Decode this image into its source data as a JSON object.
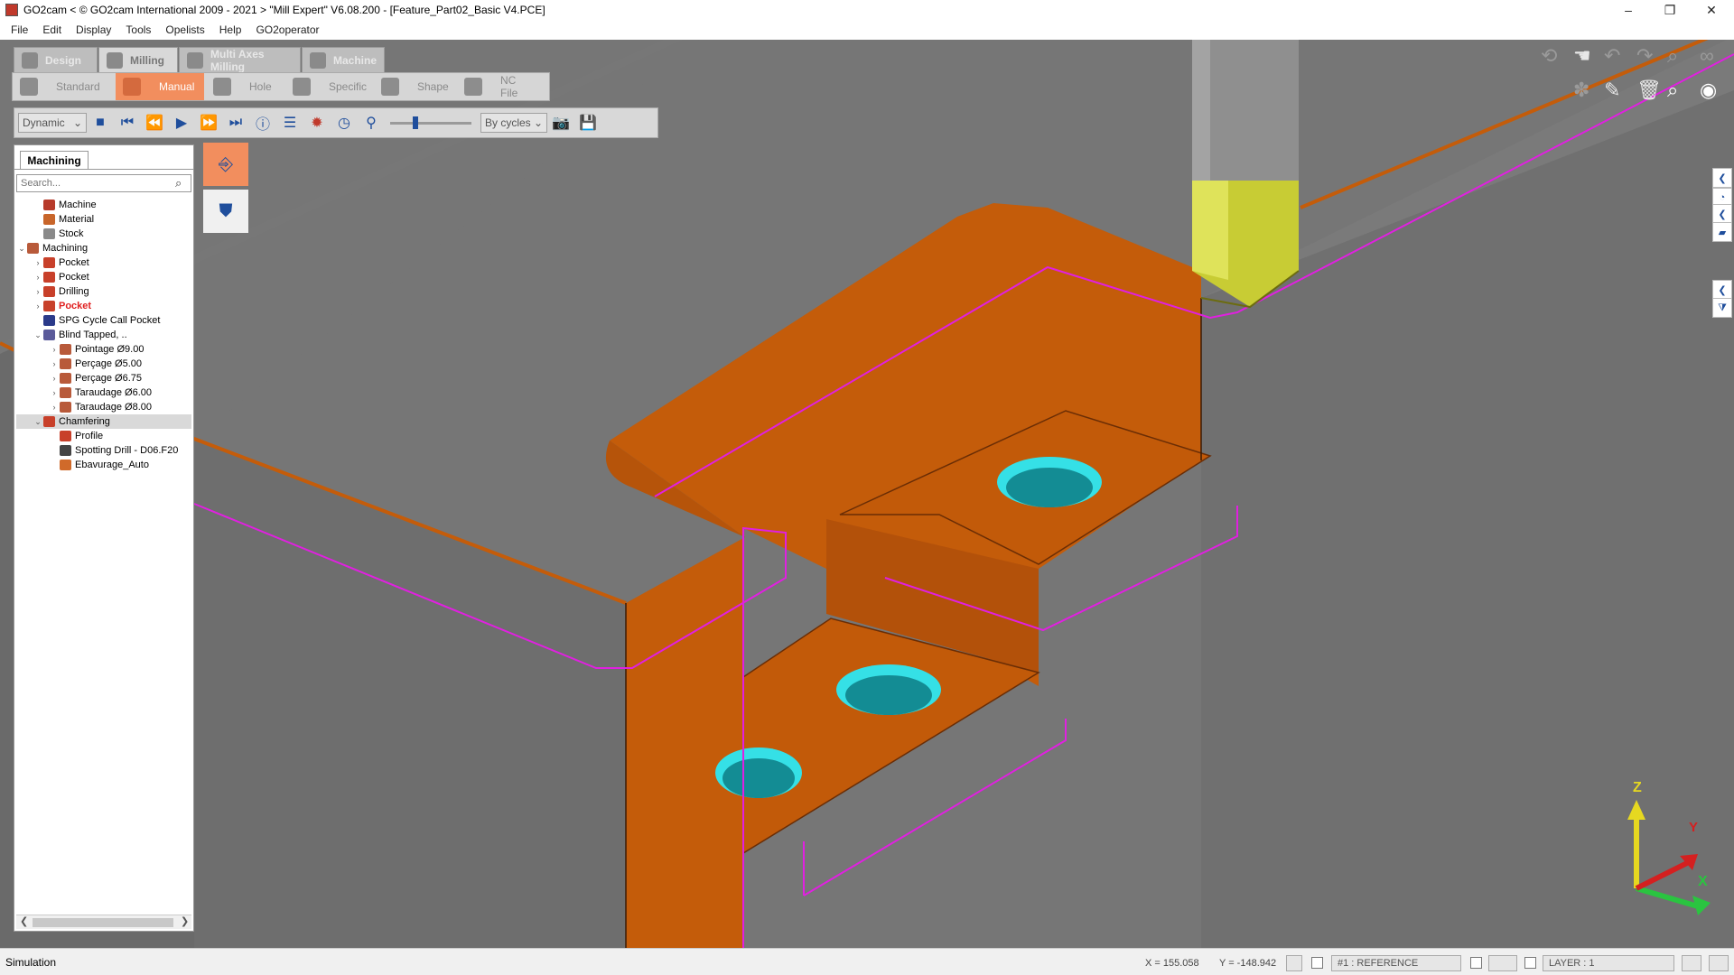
{
  "window": {
    "title": "GO2cam < © GO2cam International 2009 - 2021 >    \"Mill Expert\"   V6.08.200 - [Feature_Part02_Basic V4.PCE]",
    "minimize": "–",
    "restore": "❐",
    "close": "✕"
  },
  "menu": [
    "File",
    "Edit",
    "Display",
    "Tools",
    "Opelists",
    "Help",
    "GO2operator"
  ],
  "mode_tabs": [
    {
      "label": "Design"
    },
    {
      "label": "Milling"
    },
    {
      "label": "Multi Axes Milling"
    },
    {
      "label": "Machine"
    }
  ],
  "sub_tabs": [
    {
      "label": "Standard"
    },
    {
      "label": "Manual"
    },
    {
      "label": "Hole"
    },
    {
      "label": "Specific"
    },
    {
      "label": "Shape"
    },
    {
      "label": "NC File"
    }
  ],
  "simulation_toolbar": {
    "mode_select": "Dynamic",
    "cycle_select": "By cycles",
    "speed_level": 0.3,
    "icons": [
      "stop-icon",
      "first-icon",
      "rewind-icon",
      "play-icon",
      "fast-forward-icon",
      "last-icon",
      "info-icon",
      "settings-sliders-icon",
      "tool-collision-icon",
      "clock-icon",
      "measure-icon",
      "camera-icon",
      "save-icon"
    ]
  },
  "panel": {
    "tab": "Machining",
    "search_placeholder": "Search..."
  },
  "tree": [
    {
      "label": "Machine",
      "level": 1,
      "arrow": "",
      "color": "#b73a2a"
    },
    {
      "label": "Material",
      "level": 1,
      "arrow": "",
      "color": "#c8652a"
    },
    {
      "label": "Stock",
      "level": 1,
      "arrow": "",
      "color": "#8a8a8a"
    },
    {
      "label": "Machining",
      "level": 0,
      "arrow": "v",
      "color": "#b85a3a"
    },
    {
      "label": "Pocket",
      "level": 1,
      "arrow": ">",
      "color": "#c8402a"
    },
    {
      "label": "Pocket",
      "level": 1,
      "arrow": ">",
      "color": "#c8402a"
    },
    {
      "label": "Drilling",
      "level": 1,
      "arrow": ">",
      "color": "#c8402a"
    },
    {
      "label": "Pocket",
      "level": 1,
      "arrow": ">",
      "color": "#c8402a",
      "red": true
    },
    {
      "label": "SPG Cycle Call Pocket",
      "level": 1,
      "arrow": "",
      "color": "#2a3a8a"
    },
    {
      "label": "Blind Tapped, ..",
      "level": 1,
      "arrow": "v",
      "color": "#5a5a9a"
    },
    {
      "label": "Pointage Ø9.00",
      "level": 2,
      "arrow": ">",
      "color": "#b85a3a"
    },
    {
      "label": "Perçage Ø5.00",
      "level": 2,
      "arrow": ">",
      "color": "#b85a3a"
    },
    {
      "label": "Perçage Ø6.75",
      "level": 2,
      "arrow": ">",
      "color": "#b85a3a"
    },
    {
      "label": "Taraudage Ø6.00",
      "level": 2,
      "arrow": ">",
      "color": "#b85a3a"
    },
    {
      "label": "Taraudage Ø8.00",
      "level": 2,
      "arrow": ">",
      "color": "#b85a3a"
    },
    {
      "label": "Chamfering",
      "level": 1,
      "arrow": "v",
      "color": "#c8402a",
      "selected": true
    },
    {
      "label": "Profile",
      "level": 2,
      "arrow": "",
      "color": "#c8402a"
    },
    {
      "label": "Spotting Drill - D06.F20",
      "level": 2,
      "arrow": "",
      "color": "#444444"
    },
    {
      "label": "Ebavurage_Auto",
      "level": 2,
      "arrow": "",
      "color": "#d06a2a"
    }
  ],
  "status": {
    "text": "Simulation",
    "x": "X = 155.058",
    "y": "Y = -148.942",
    "reference": "#1 : REFERENCE",
    "layer": "LAYER : 1"
  },
  "axes": {
    "x": "X",
    "y": "Y",
    "z": "Z"
  },
  "colors": {
    "accent": "#f28e5e",
    "part": "#c45c0a",
    "hole": "#1aa8b0",
    "toolpath": "#e020e0",
    "viewport": "#767676"
  }
}
